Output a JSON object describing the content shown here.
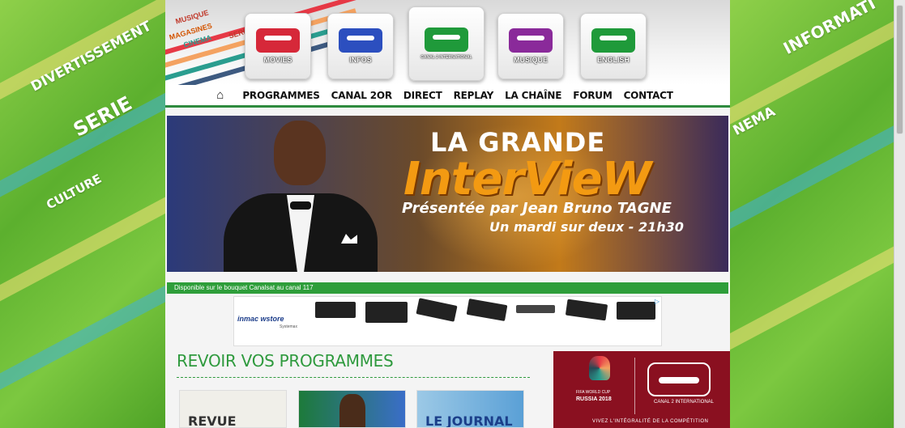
{
  "side_left": {
    "words": [
      "DIVERTISSEMENT",
      "SERIE",
      "CULTURE"
    ]
  },
  "side_right": {
    "words": [
      "INFORMATI",
      "NEMA"
    ]
  },
  "header": {
    "words": [
      "MUSIQUE",
      "MAGASINES",
      "CINEMA",
      "SERIE"
    ],
    "channels": [
      {
        "label": "MOVIES",
        "color": "#d62839"
      },
      {
        "label": "INFOS",
        "color": "#2c4fbf"
      },
      {
        "label": "CANAL 2 INTERNATIONAL",
        "color": "#1f9a3a"
      },
      {
        "label": "MUSIQUE",
        "color": "#8a2a9a"
      },
      {
        "label": "ENGLISH",
        "color": "#1f9a3a"
      }
    ]
  },
  "nav": {
    "home_icon": "home-icon",
    "items": [
      "PROGRAMMES",
      "CANAL 2OR",
      "DIRECT",
      "REPLAY",
      "LA CHAÎNE",
      "FORUM",
      "CONTACT"
    ]
  },
  "banner": {
    "line1": "LA GRANDE",
    "line2": "InterVieW",
    "line3": "Présentée par Jean Bruno TAGNE",
    "line4": "Un mardi sur deux - 21h30"
  },
  "caption": "Disponible sur le bouquet Canalsat au canal 117",
  "ad": {
    "brand": "inmac wstore",
    "brand_sub": "Systemax",
    "adchoices_icon": "adchoices-icon"
  },
  "revoir": {
    "title": "REVOIR VOS PROGRAMMES",
    "thumbs": [
      {
        "title": "REVUE"
      },
      {
        "title": ""
      },
      {
        "title": "LE JOURNAL"
      }
    ]
  },
  "worldcup": {
    "event_small": "FIFA WORLD CUP",
    "event": "RUSSIA 2018",
    "channel": "CANAL 2 INTERNATIONAL",
    "tagline": "VIVEZ L'INTÉGRALITÉ DE LA COMPÉTITION"
  }
}
